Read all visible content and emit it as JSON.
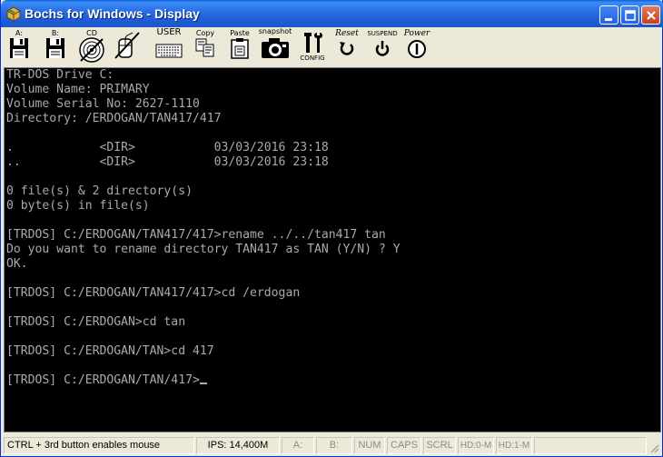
{
  "window": {
    "title": "Bochs for Windows - Display"
  },
  "toolbar": {
    "items": [
      {
        "label": "A:",
        "icon": "floppy-a-icon"
      },
      {
        "label": "B:",
        "icon": "floppy-b-icon"
      },
      {
        "label": "CD",
        "icon": "cdrom-icon"
      },
      {
        "label": "",
        "icon": "mouse-icon"
      },
      {
        "label": "USER",
        "icon": "keyboard-icon"
      },
      {
        "label": "Copy",
        "icon": "copy-icon"
      },
      {
        "label": "Paste",
        "icon": "paste-icon"
      },
      {
        "label": "snapshot",
        "icon": "camera-icon"
      },
      {
        "label": "CONFIG",
        "icon": "config-icon"
      },
      {
        "label": "Reset",
        "icon": "reset-icon"
      },
      {
        "label": "SUSPEND",
        "icon": "suspend-icon"
      },
      {
        "label": "Power",
        "icon": "power-icon"
      }
    ]
  },
  "terminal": {
    "lines": [
      "TR-DOS Drive C:",
      "Volume Name: PRIMARY",
      "Volume Serial No: 2627-1110",
      "Directory: /ERDOGAN/TAN417/417",
      "",
      ".            <DIR>           03/03/2016 23:18",
      "..           <DIR>           03/03/2016 23:18",
      "",
      "0 file(s) & 2 directory(s)",
      "0 byte(s) in file(s)",
      "",
      "[TRDOS] C:/ERDOGAN/TAN417/417>rename ../../tan417 tan",
      "Do you want to rename directory TAN417 as TAN (Y/N) ? Y",
      "OK.",
      "",
      "[TRDOS] C:/ERDOGAN/TAN417/417>cd /erdogan",
      "",
      "[TRDOS] C:/ERDOGAN>cd tan",
      "",
      "[TRDOS] C:/ERDOGAN/TAN>cd 417",
      "",
      "[TRDOS] C:/ERDOGAN/TAN/417>"
    ]
  },
  "statusbar": {
    "mouse_hint": "CTRL + 3rd button enables mouse",
    "ips": "IPS: 14,400M",
    "a": "A:",
    "b": "B:",
    "num": "NUM",
    "caps": "CAPS",
    "scrl": "SCRL",
    "hd0": "HD:0-M",
    "hd1": "HD:1-M"
  }
}
